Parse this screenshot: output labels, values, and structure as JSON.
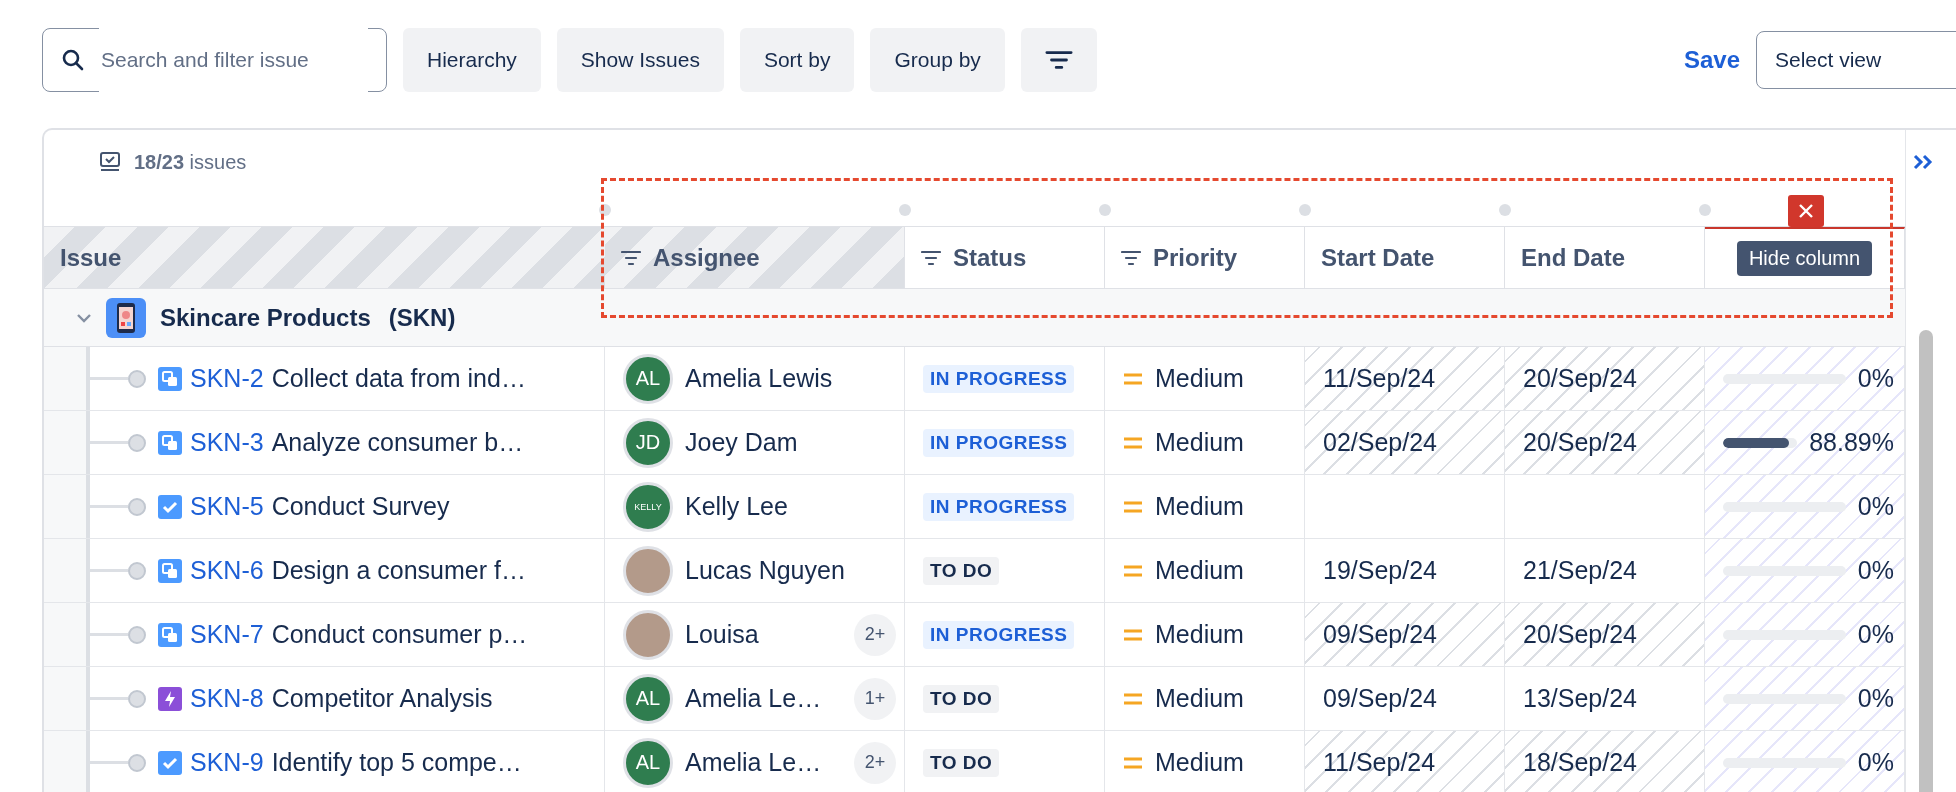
{
  "toolbar": {
    "search": {
      "placeholder": "Search and filter issue"
    },
    "buttons": [
      "Hierarchy",
      "Show Issues",
      "Sort by",
      "Group by"
    ],
    "save": "Save",
    "view_select": {
      "value": "Select view"
    }
  },
  "summary": {
    "text": "**18/23** issues"
  },
  "columns": [
    {
      "label": "Issue",
      "filter": false,
      "selected": false
    },
    {
      "label": "Assignee",
      "filter": true,
      "selected": false
    },
    {
      "label": "Status",
      "filter": true,
      "selected": false
    },
    {
      "label": "Priority",
      "filter": true,
      "selected": false
    },
    {
      "label": "Start Date",
      "filter": false,
      "selected": false
    },
    {
      "label": "End Date",
      "filter": false,
      "selected": false
    },
    {
      "tooltip": "Hide column",
      "filter": false,
      "selected": true
    }
  ],
  "group": {
    "name": "Skincare Products",
    "key": "(SKN)",
    "expanded": true
  },
  "rows": [
    {
      "key": "SKN-2",
      "title": "Collect data from ind…",
      "kind": "subtask",
      "assignee": {
        "name": "Amelia Lewis",
        "kind": "initials",
        "initials": "AL"
      },
      "status": {
        "label": "IN PROGRESS",
        "kind": "in_progress"
      },
      "priority": "Medium",
      "start": "11/Sep/24",
      "end": "20/Sep/24",
      "dates_hatched": true,
      "progress": {
        "level": 0,
        "label": "0%"
      }
    },
    {
      "key": "SKN-3",
      "title": "Analyze consumer b…",
      "kind": "subtask",
      "assignee": {
        "name": "Joey Dam",
        "kind": "initials",
        "initials": "JD"
      },
      "status": {
        "label": "IN PROGRESS",
        "kind": "in_progress"
      },
      "priority": "Medium",
      "start": "02/Sep/24",
      "end": "20/Sep/24",
      "dates_hatched": true,
      "progress": {
        "level": 0.8889,
        "label": "88.89%"
      }
    },
    {
      "key": "SKN-5",
      "title": "Conduct Survey",
      "kind": "task",
      "assignee": {
        "name": "Kelly Lee",
        "kind": "initials",
        "initials": "KELLY"
      },
      "status": {
        "label": "IN PROGRESS",
        "kind": "in_progress"
      },
      "priority": "Medium",
      "dates_hatched": false,
      "progress": {
        "level": 0,
        "label": "0%"
      }
    },
    {
      "key": "SKN-6",
      "title": "Design a consumer f…",
      "kind": "subtask",
      "assignee": {
        "name": "Lucas Nguyen",
        "kind": "photo"
      },
      "status": {
        "label": "TO DO",
        "kind": "todo"
      },
      "priority": "Medium",
      "start": "19/Sep/24",
      "end": "21/Sep/24",
      "dates_hatched": false,
      "progress": {
        "level": 0,
        "label": "0%"
      }
    },
    {
      "key": "SKN-7",
      "title": "Conduct consumer p…",
      "kind": "subtask",
      "assignee": {
        "name": "Louisa",
        "kind": "photo",
        "extra": "2+"
      },
      "status": {
        "label": "IN PROGRESS",
        "kind": "in_progress"
      },
      "priority": "Medium",
      "start": "09/Sep/24",
      "end": "20/Sep/24",
      "dates_hatched": true,
      "progress": {
        "level": 0,
        "label": "0%"
      }
    },
    {
      "key": "SKN-8",
      "title": "Competitor Analysis",
      "kind": "epic",
      "assignee": {
        "name": "Amelia Le…",
        "kind": "initials",
        "initials": "AL",
        "extra": "1+"
      },
      "status": {
        "label": "TO DO",
        "kind": "todo"
      },
      "priority": "Medium",
      "start": "09/Sep/24",
      "end": "13/Sep/24",
      "dates_hatched": false,
      "progress": {
        "level": 0,
        "label": "0%"
      }
    },
    {
      "key": "SKN-9",
      "title": "Identify top 5 compe…",
      "kind": "task",
      "assignee": {
        "name": "Amelia Le…",
        "kind": "initials",
        "initials": "AL",
        "extra": "2+"
      },
      "status": {
        "label": "TO DO",
        "kind": "todo"
      },
      "priority": "Medium",
      "start": "11/Sep/24",
      "end": "18/Sep/24",
      "dates_hatched": true,
      "progress": {
        "level": 0,
        "label": "0%"
      }
    }
  ]
}
